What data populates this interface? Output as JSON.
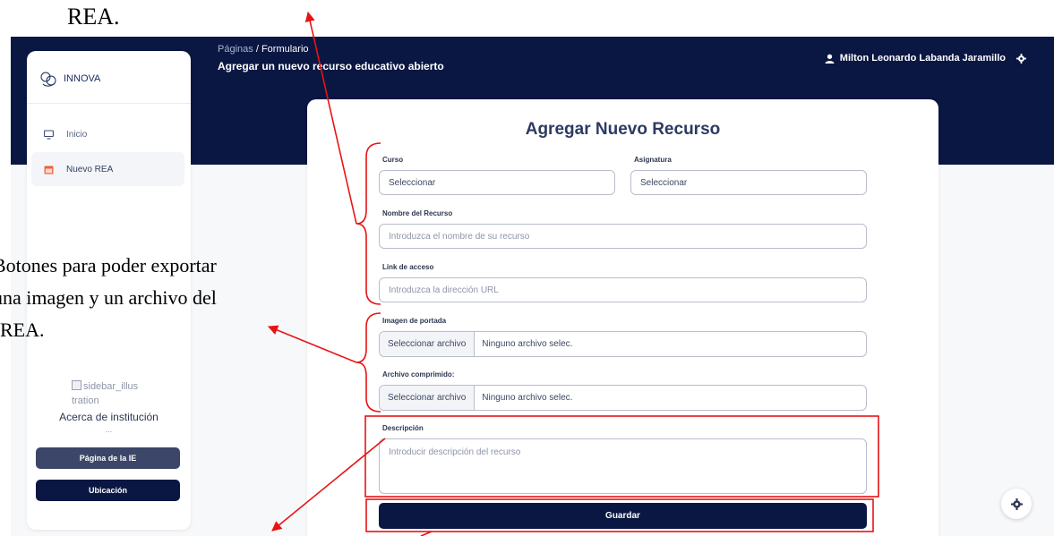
{
  "caption": {
    "top_text": "REA.",
    "side_lines": [
      "Botones para poder exportar",
      "una imagen y un archivo del",
      "REA."
    ]
  },
  "header": {
    "breadcrumb_parent": "Páginas",
    "breadcrumb_separator": "/",
    "breadcrumb_current": "Formulario",
    "page_title": "Agregar un nuevo recurso educativo abierto",
    "user_name": "Milton Leonardo Labanda Jaramillo",
    "user_icon": "user-icon",
    "settings_icon": "gear-icon"
  },
  "sidebar": {
    "brand": "INNOVA",
    "items": [
      {
        "label": "Inicio",
        "icon": "monitor-icon"
      },
      {
        "label": "Nuevo REA",
        "icon": "calendar-icon"
      }
    ],
    "illustration_alt_1": "sidebar_illus",
    "illustration_alt_2": "tration",
    "about_title": "Acerca de institución",
    "about_dots": "...",
    "button_ie": "Página de la IE",
    "button_location": "Ubicación"
  },
  "form": {
    "title": "Agregar Nuevo Recurso",
    "curso_label": "Curso",
    "curso_value": "Seleccionar",
    "asignatura_label": "Asignatura",
    "asignatura_value": "Seleccionar",
    "nombre_label": "Nombre del Recurso",
    "nombre_placeholder": "Introduzca el nombre de su recurso",
    "link_label": "Link de acceso",
    "link_placeholder": "Introduzca la dirección URL",
    "portada_label": "Imagen de portada",
    "portada_button": "Seleccionar archivo",
    "portada_file": "Ninguno archivo selec.",
    "comprimido_label": "Archivo comprimido:",
    "comprimido_button": "Seleccionar archivo",
    "comprimido_file": "Ninguno archivo selec.",
    "descripcion_label": "Descripción",
    "descripcion_placeholder": "Introducir descripción del recurso",
    "submit_label": "Guardar"
  },
  "colors": {
    "navy": "#0a1743",
    "annotation_red": "#e81313"
  }
}
